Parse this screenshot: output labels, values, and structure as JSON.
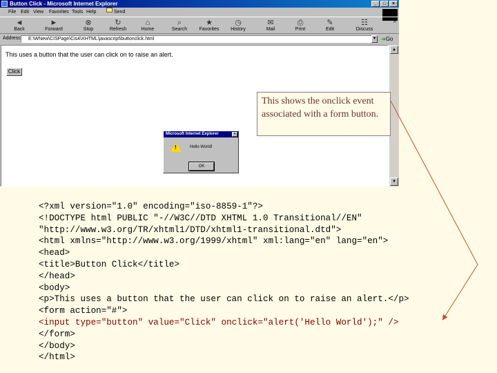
{
  "window": {
    "title": "Button Click - Microsoft Internet Explorer"
  },
  "menu": {
    "items": [
      "File",
      "Edit",
      "View",
      "Favorites",
      "Tools",
      "Help"
    ],
    "send_label": "Send"
  },
  "toolbar": {
    "buttons": [
      {
        "label": "Back",
        "icon": "back-arrow-icon"
      },
      {
        "label": "Forward",
        "icon": "forward-arrow-icon"
      },
      {
        "label": "Stop",
        "icon": "stop-icon"
      },
      {
        "label": "Refresh",
        "icon": "refresh-icon"
      },
      {
        "label": "Home",
        "icon": "home-icon"
      },
      {
        "label": "Search",
        "icon": "search-icon"
      },
      {
        "label": "Favorites",
        "icon": "favorites-icon"
      },
      {
        "label": "History",
        "icon": "history-icon"
      },
      {
        "label": "Mail",
        "icon": "mail-icon"
      },
      {
        "label": "Print",
        "icon": "print-icon"
      },
      {
        "label": "Edit",
        "icon": "edit-icon"
      },
      {
        "label": "Discuss",
        "icon": "discuss-icon"
      }
    ]
  },
  "address": {
    "label": "Address",
    "value": "E:\\WNew\\CISPage\\Cis4\\XHTML\\javascript\\buttonclick.html",
    "go_label": "Go"
  },
  "page": {
    "paragraph": "This uses a button that the user can click on to raise an alert.",
    "button_label": "Click"
  },
  "dialog": {
    "title": "Microsoft Internet Explorer",
    "message": "Hello World!",
    "ok_label": "OK"
  },
  "callout": {
    "text": "This shows the onclick event associated with a form button."
  },
  "code": {
    "lines": [
      "<?xml version=\"1.0\" encoding=\"iso-8859-1\"?>",
      "<!DOCTYPE html PUBLIC \"-//W3C//DTD XHTML 1.0 Transitional//EN\"",
      "\"http://www.w3.org/TR/xhtml1/DTD/xhtml1-transitional.dtd\">",
      "<html xmlns=\"http://www.w3.org/1999/xhtml\" xml:lang=\"en\" lang=\"en\">",
      "<head>",
      "<title>Button Click</title>",
      "</head>",
      "<body>",
      "<p>This uses a button that the user can click on to raise an alert.</p>",
      "<form action=\"#\">",
      "<input type=\"button\" value=\"Click\" onclick=\"alert('Hello World');\" />",
      "</form>",
      "</body>",
      "</html>"
    ],
    "highlight_line": 10
  },
  "colors": {
    "slide_background": "#fffbe6",
    "highlight_code": "#800000",
    "arrow": "#c05030",
    "callout_text": "#663333"
  }
}
